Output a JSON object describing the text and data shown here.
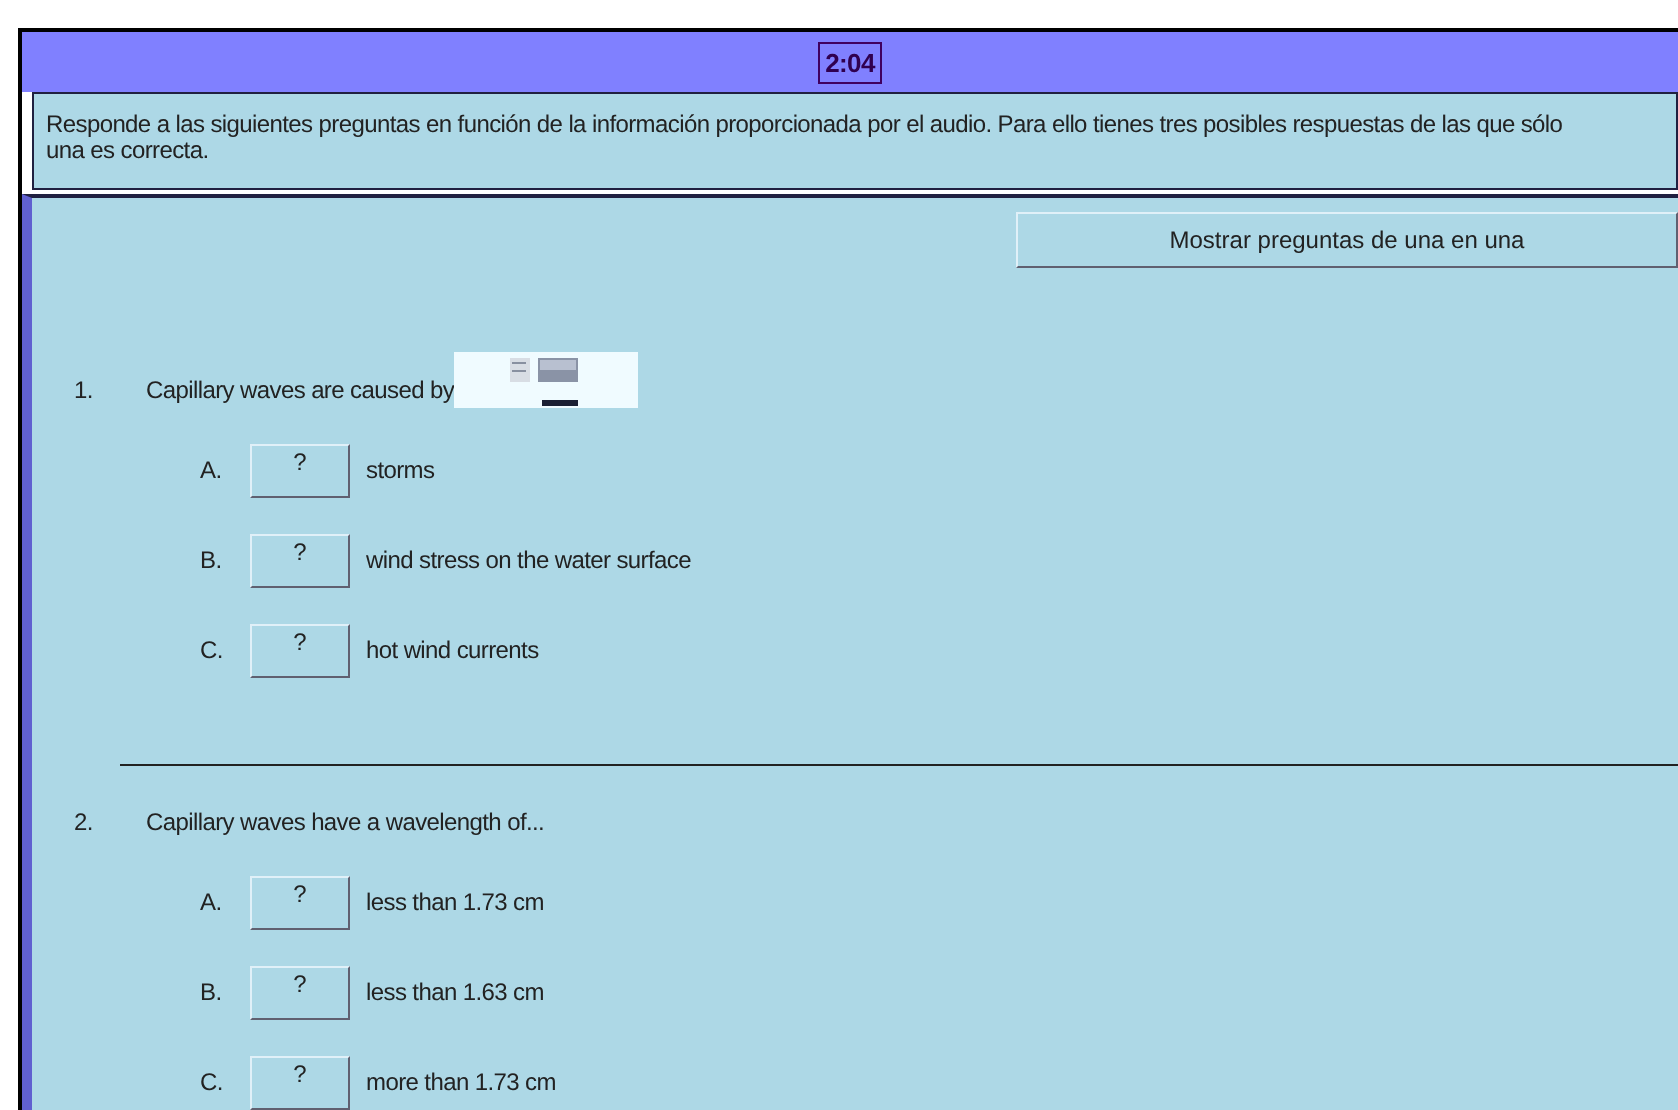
{
  "timer": "2:04",
  "instructions": "Responde a las siguientes preguntas en función de la información proporcionada por el audio. Para ello tienes tres posibles respuestas de las que sólo una es correcta.",
  "show_one_button": "Mostrar preguntas de una en una",
  "questions": [
    {
      "number": "1.",
      "text": "Capillary waves are caused by",
      "has_picture": true,
      "options": [
        {
          "letter": "A.",
          "button": "?",
          "text": "storms"
        },
        {
          "letter": "B.",
          "button": "?",
          "text": "wind stress on the water surface"
        },
        {
          "letter": "C.",
          "button": "?",
          "text": "hot wind currents"
        }
      ]
    },
    {
      "number": "2.",
      "text": "Capillary waves have a wavelength of...",
      "has_picture": false,
      "options": [
        {
          "letter": "A.",
          "button": "?",
          "text": "less than 1.73 cm"
        },
        {
          "letter": "B.",
          "button": "?",
          "text": "less than 1.63 cm"
        },
        {
          "letter": "C.",
          "button": "?",
          "text": "more than 1.73 cm"
        }
      ]
    }
  ]
}
